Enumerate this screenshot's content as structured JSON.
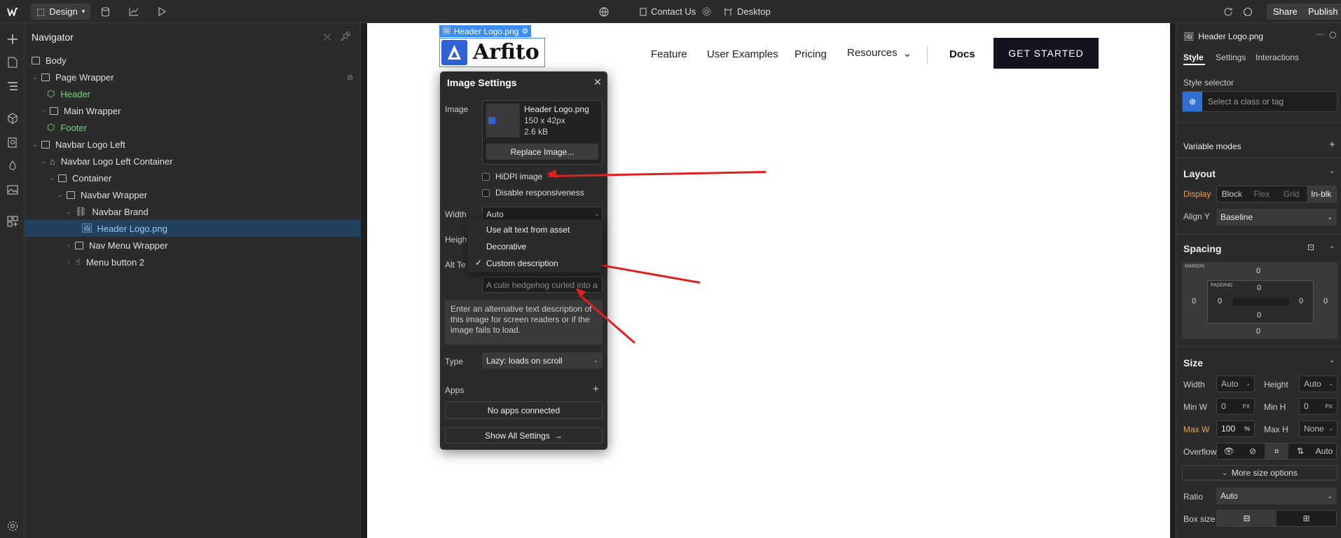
{
  "topbar": {
    "design_label": "Design",
    "page_name": "Contact Us",
    "breakpoint": "Desktop",
    "share_label": "Share",
    "publish_label": "Publish"
  },
  "navigator": {
    "title": "Navigator",
    "items": [
      {
        "label": "Body"
      },
      {
        "label": "Page Wrapper"
      },
      {
        "label": "Header"
      },
      {
        "label": "Main Wrapper"
      },
      {
        "label": "Footer"
      },
      {
        "label": "Navbar Logo Left"
      },
      {
        "label": "Navbar Logo Left Container"
      },
      {
        "label": "Container"
      },
      {
        "label": "Navbar Wrapper"
      },
      {
        "label": "Navbar Brand"
      },
      {
        "label": "Header Logo.png"
      },
      {
        "label": "Nav Menu Wrapper"
      },
      {
        "label": "Menu button 2"
      }
    ]
  },
  "canvas": {
    "selected_tag": "Header Logo.png",
    "logo_text": "Arfito",
    "nav_links": [
      "Feature",
      "User Examples",
      "Pricing",
      "Resources"
    ],
    "docs_label": "Docs",
    "cta_label": "GET STARTED"
  },
  "image_settings": {
    "title": "Image Settings",
    "image_label": "Image",
    "file_name": "Header Logo.png",
    "dimensions": "150 x 42px",
    "file_size": "2.6 kB",
    "replace_label": "Replace Image...",
    "hidpi_label": "HiDPI image",
    "disable_resp_label": "Disable responsiveness",
    "width_label": "Width",
    "width_value": "Auto",
    "height_label": "Heigh",
    "alt_label": "Alt Te",
    "alt_placeholder": "A cute hedgehog curled into a",
    "help_text": "Enter an alternative text description of this image for screen readers or if the image fails to load.",
    "type_label": "Type",
    "type_value": "Lazy: loads on scroll",
    "apps_label": "Apps",
    "no_apps": "No apps connected",
    "show_all": "Show All Settings"
  },
  "alt_dropdown": {
    "options": [
      "Use alt text from asset",
      "Decorative",
      "Custom description"
    ],
    "selected": "Custom description"
  },
  "right_panel": {
    "element_name": "Header Logo.png",
    "tabs": [
      "Style",
      "Settings",
      "Interactions"
    ],
    "style_selector_label": "Style selector",
    "selector_placeholder": "Select a class or tag",
    "variable_modes": "Variable modes",
    "layout": "Layout",
    "display_label": "Display",
    "display_options": [
      "Block",
      "Flex",
      "Grid",
      "In-blk"
    ],
    "align_y_label": "Align Y",
    "align_y_value": "Baseline",
    "spacing": "Spacing",
    "margin_label": "MARGIN",
    "padding_label": "PADDING",
    "zero": "0",
    "size": "Size",
    "width_label": "Width",
    "width_value": "Auto",
    "height_label": "Height",
    "height_value": "Auto",
    "min_w_label": "Min W",
    "min_w_value": "0",
    "min_h_label": "Min H",
    "min_h_value": "0",
    "px": "PX",
    "max_w_label": "Max W",
    "max_w_value": "100",
    "pct": "%",
    "max_h_label": "Max H",
    "max_h_value": "None",
    "overflow_label": "Overflow",
    "overflow_auto": "Auto",
    "more_size": "More size options",
    "ratio_label": "Ratio",
    "ratio_value": "Auto",
    "box_size_label": "Box size"
  },
  "colors": {
    "accent": "#3b8df5",
    "arrow": "#e01f1f",
    "green": "#7fd38a",
    "orange": "#e8a05a"
  }
}
